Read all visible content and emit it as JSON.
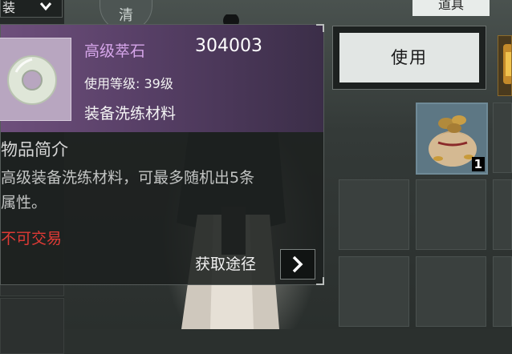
{
  "top_left": {
    "dropdown_label": "装",
    "dropdown_icon": "chevron-down-icon"
  },
  "emblem": {
    "label": "清"
  },
  "bag_tab": {
    "label": "道具"
  },
  "use_button": {
    "label": "使用"
  },
  "inventory": {
    "selected_item_count": "1",
    "selected_item_icon": "money-bag-icon"
  },
  "tooltip": {
    "item_name": "高级萃石",
    "item_id": "304003",
    "level_line": "使用等级: 39级",
    "category": "装备洗练材料",
    "intro_title": "物品简介",
    "intro_line1": "高级装备洗练材料，可最多随机出5条",
    "intro_line2": "属性。",
    "trade_status": "不可交易",
    "obtain_label": "获取途径",
    "obtain_icon": "chevron-right-icon",
    "item_icon": "jade-ring-icon"
  },
  "colors": {
    "item_name": "#d6a6ea",
    "trade_status": "#e03a35",
    "header_purple": "#6e4f7c"
  }
}
